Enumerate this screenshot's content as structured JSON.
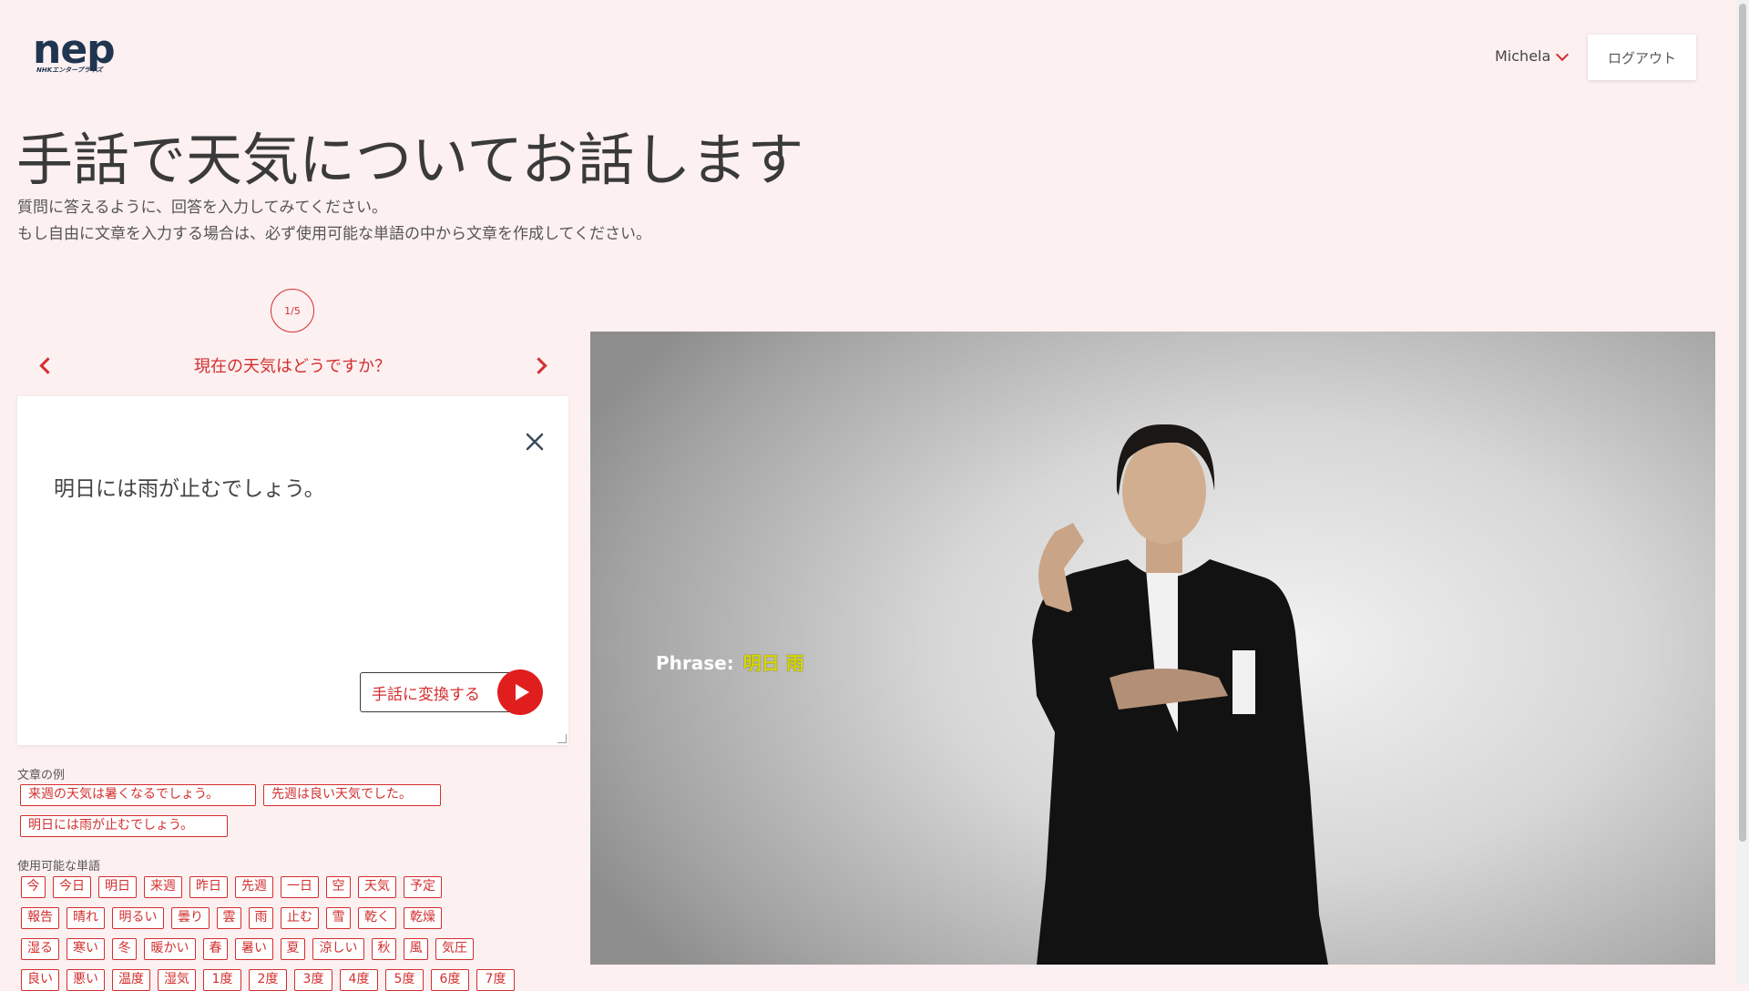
{
  "header": {
    "logo_text": "nep",
    "logo_subtext": "NHKエンタープライズ",
    "user_name": "Michela",
    "logout_label": "ログアウト"
  },
  "page": {
    "title": "手話で天気についてお話します",
    "instructions": [
      "質問に答えるように、回答を入力してみてください。",
      "もし自由に文章を入力する場合は、必ず使用可能な単語の中から文章を作成してください。"
    ]
  },
  "quiz": {
    "step": "1/5",
    "question": "現在の天気はどうですか？",
    "answer_text": "明日には雨が止むでしょう。",
    "convert_label": "手話に変換する"
  },
  "examples": {
    "label": "文章の例",
    "items": [
      "来週の天気は暑くなるでしょう。",
      "先週は良い天気でした。",
      "明日には雨が止むでしょう。"
    ]
  },
  "vocabulary": {
    "label": "使用可能な単語",
    "rows": [
      [
        "今",
        "今日",
        "明日",
        "来週",
        "昨日",
        "先週",
        "一日",
        "空",
        "天気",
        "予定"
      ],
      [
        "報告",
        "晴れ",
        "明るい",
        "曇り",
        "雲",
        "雨",
        "止む",
        "雪",
        "乾く",
        "乾燥"
      ],
      [
        "湿る",
        "寒い",
        "冬",
        "暖かい",
        "春",
        "暑い",
        "夏",
        "涼しい",
        "秋",
        "風",
        "気圧"
      ],
      [
        "良い",
        "悪い",
        "温度",
        "湿気",
        "1度",
        "2度",
        "3度",
        "4度",
        "5度",
        "6度",
        "7度"
      ]
    ]
  },
  "video": {
    "phrase_label": "Phrase:",
    "phrase_value": "明日 雨"
  },
  "colors": {
    "accent": "#d32f2f",
    "background": "#fdf0f1",
    "play_button": "#e01e1e",
    "phrase_text": "#d8d800"
  }
}
